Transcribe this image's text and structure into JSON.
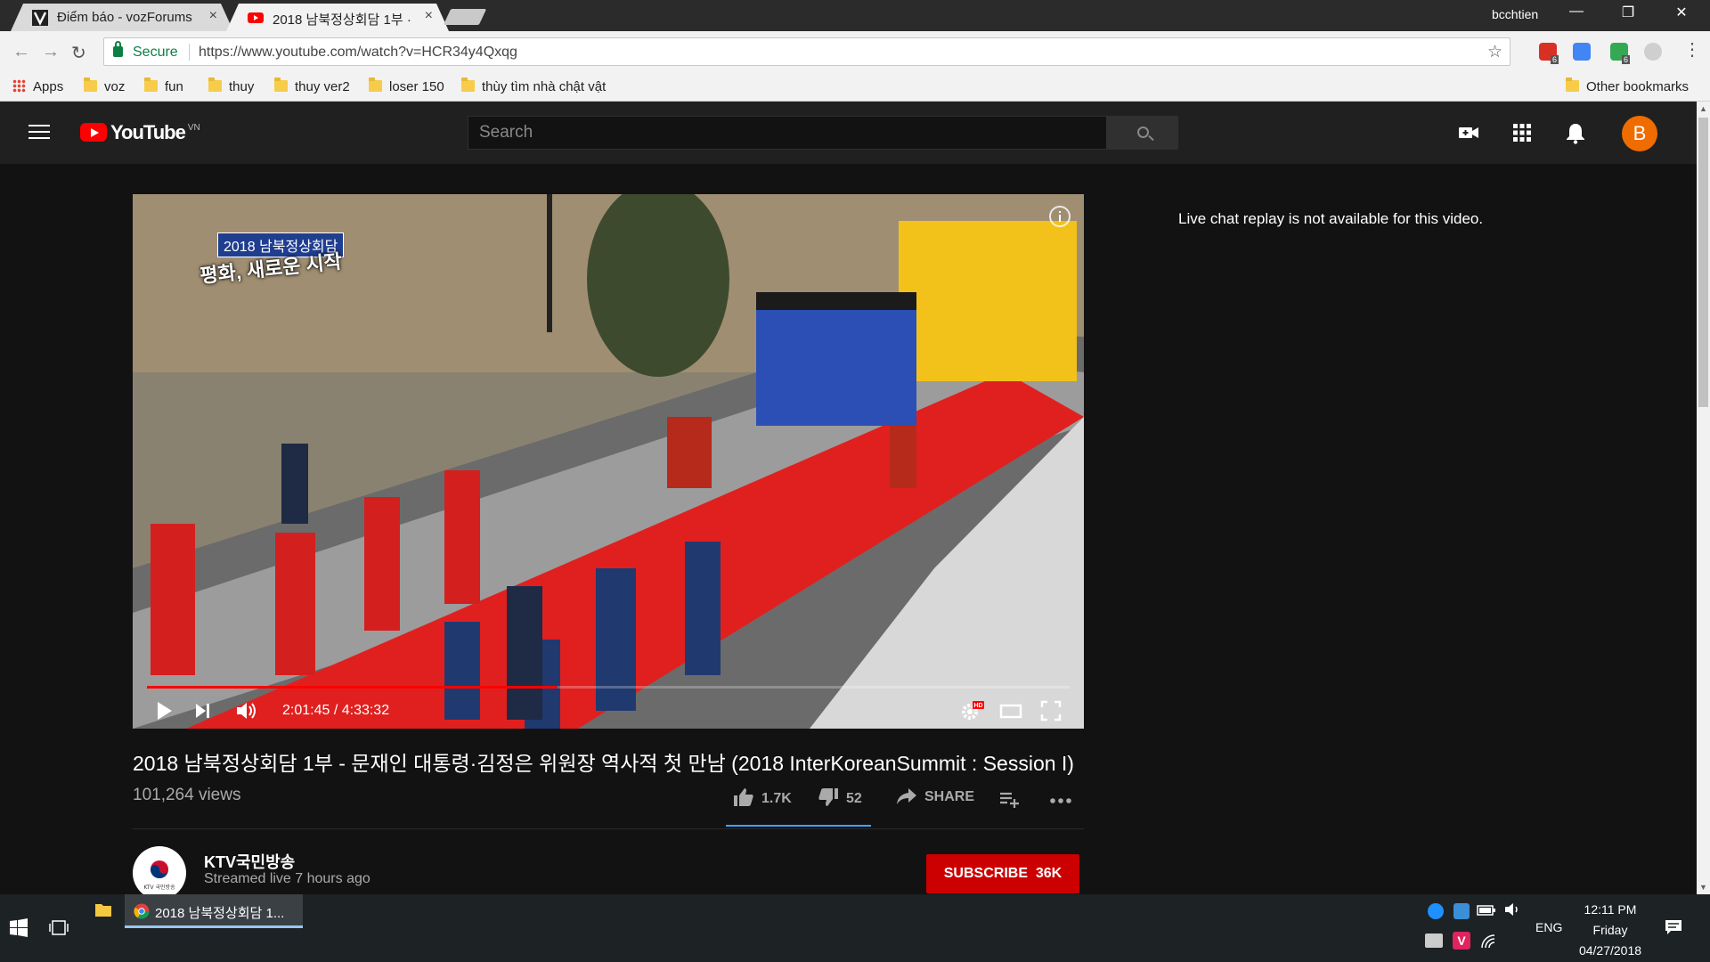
{
  "browser": {
    "tabs": [
      {
        "title": "Điểm báo - vozForums",
        "close": "×"
      },
      {
        "title": "2018 남북정상회담 1부 · ",
        "close": "×"
      }
    ],
    "user": "bcchtien",
    "window_buttons": {
      "minimize": "—",
      "restore": "❐",
      "close": "✕"
    },
    "secure_label": "Secure",
    "url": "https://www.youtube.com/watch?v=HCR34y4Qxqg",
    "bookmarks": [
      {
        "label": "Apps"
      },
      {
        "label": "voz"
      },
      {
        "label": "fun"
      },
      {
        "label": "thuy"
      },
      {
        "label": "thuy ver2"
      },
      {
        "label": "loser 150"
      },
      {
        "label": "thùy tìm nhà chật vật"
      }
    ],
    "other_bookmarks": "Other bookmarks",
    "extension_badges": [
      "6",
      "6"
    ]
  },
  "youtube": {
    "logo_text": "YouTube",
    "region": "VN",
    "search_placeholder": "Search",
    "avatar_letter": "B",
    "player": {
      "current_time": "2:01:45",
      "duration": "4:33:32",
      "time_display": "2:01:45 / 4:33:32",
      "progress_fraction": 0.445,
      "buffered_fraction": 0.445,
      "overlay_badge": "2018 남북정상회담",
      "overlay_subtitle": "평화, 새로운 시작",
      "hd_badge": "HD"
    },
    "video": {
      "title": "2018 남북정상회담 1부 - 문재인 대통령·김정은 위원장 역사적 첫 만남 (2018 InterKoreanSummit : Session I)",
      "views": "101,264 views",
      "likes": "1.7K",
      "dislikes": "52",
      "share_label": "SHARE",
      "like_ratio": 0.97
    },
    "channel": {
      "name": "KTV국민방송",
      "streamed": "Streamed live 7 hours ago",
      "logo_text": "KTV 국민방송",
      "subscribe_label": "SUBSCRIBE",
      "subscriber_count": "36K"
    },
    "chat_note": "Live chat replay is not available for this video."
  },
  "taskbar": {
    "active_window": "2018 남북정상회담 1...",
    "language": "ENG",
    "time": "12:11 PM",
    "day": "Friday",
    "date": "04/27/2018"
  },
  "colors": {
    "brand_red": "#ff0000",
    "subscribe_red": "#cc0000",
    "secure_green": "#0b8043",
    "avatar_orange": "#ef6c00",
    "like_blue": "#3ea6ff"
  }
}
